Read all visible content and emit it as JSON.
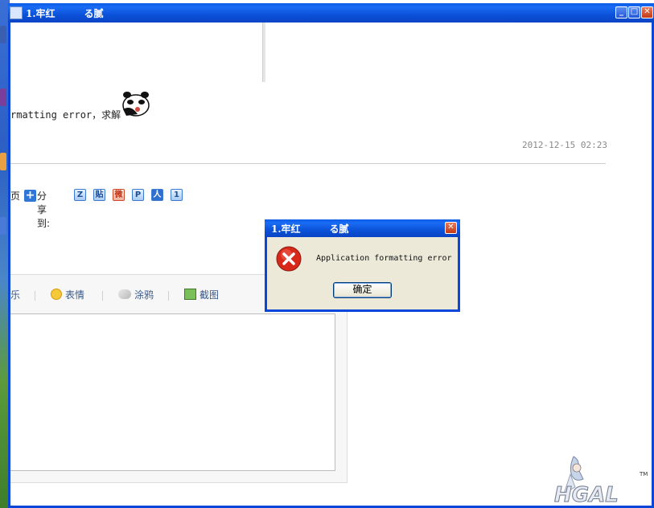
{
  "window": {
    "title": "1.牢红　　　る腻",
    "minimize_label": "_",
    "maximize_label": "□",
    "close_label": "✕"
  },
  "post": {
    "text": "rmatting error，求解",
    "timestamp": "2012-12-15 02:23"
  },
  "share": {
    "left_text": "页",
    "label": "分享到:",
    "icons": [
      {
        "name": "qzone-icon",
        "glyph": "Z"
      },
      {
        "name": "tieba-icon",
        "glyph": "贴"
      },
      {
        "name": "weibo-icon",
        "glyph": "微"
      },
      {
        "name": "pengyou-icon",
        "glyph": "P"
      },
      {
        "name": "renren-icon",
        "glyph": "人"
      },
      {
        "name": "kaixin-icon",
        "glyph": "1"
      }
    ]
  },
  "editor": {
    "tools": {
      "music": "乐",
      "emoji": "表情",
      "doodle": "涂鸦",
      "screenshot": "截图"
    }
  },
  "dialog": {
    "title": "1.牢红　　　る腻",
    "message": "Application formatting error",
    "ok_label": "确定",
    "close_label": "✕"
  },
  "logo": {
    "text": "HGAL",
    "tm": "TM"
  },
  "colors": {
    "titlebar": "#0a52d8",
    "dialog_body": "#ece9d8",
    "error_red": "#d8281a"
  }
}
